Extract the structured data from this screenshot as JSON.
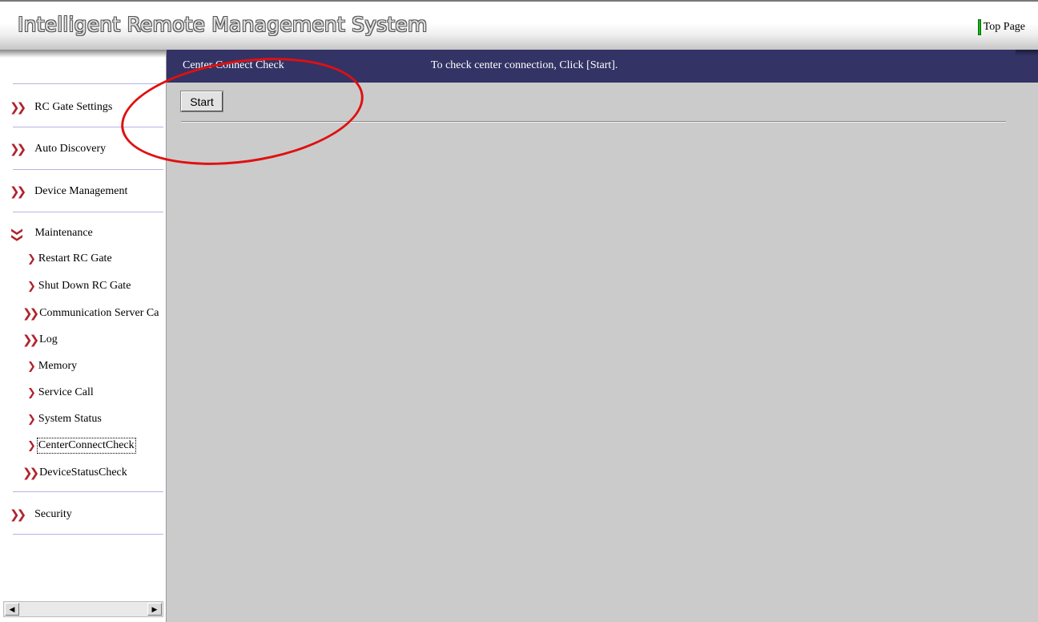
{
  "app": {
    "title": "Intelligent Remote Management System",
    "top_link": "Top Page"
  },
  "sidebar": {
    "items": [
      {
        "label": "RC Gate Settings"
      },
      {
        "label": "Auto Discovery"
      },
      {
        "label": "Device Management"
      },
      {
        "label": "Maintenance"
      },
      {
        "label": "Restart RC Gate"
      },
      {
        "label": "Shut Down RC Gate"
      },
      {
        "label": "Communication Server Ca"
      },
      {
        "label": "Log"
      },
      {
        "label": "Memory"
      },
      {
        "label": "Service Call"
      },
      {
        "label": "System Status"
      },
      {
        "label": "CenterConnectCheck"
      },
      {
        "label": "DeviceStatusCheck"
      },
      {
        "label": "Security"
      }
    ]
  },
  "content": {
    "header_title": "Center Connect Check",
    "header_message": "To check center connection, Click [Start].",
    "start_button": "Start"
  },
  "colors": {
    "header_bg": "#333366",
    "content_bg": "#cbcbcb",
    "arrow": "#b0242e",
    "annotation": "#e01010",
    "top_link_marker": "#19b219"
  }
}
